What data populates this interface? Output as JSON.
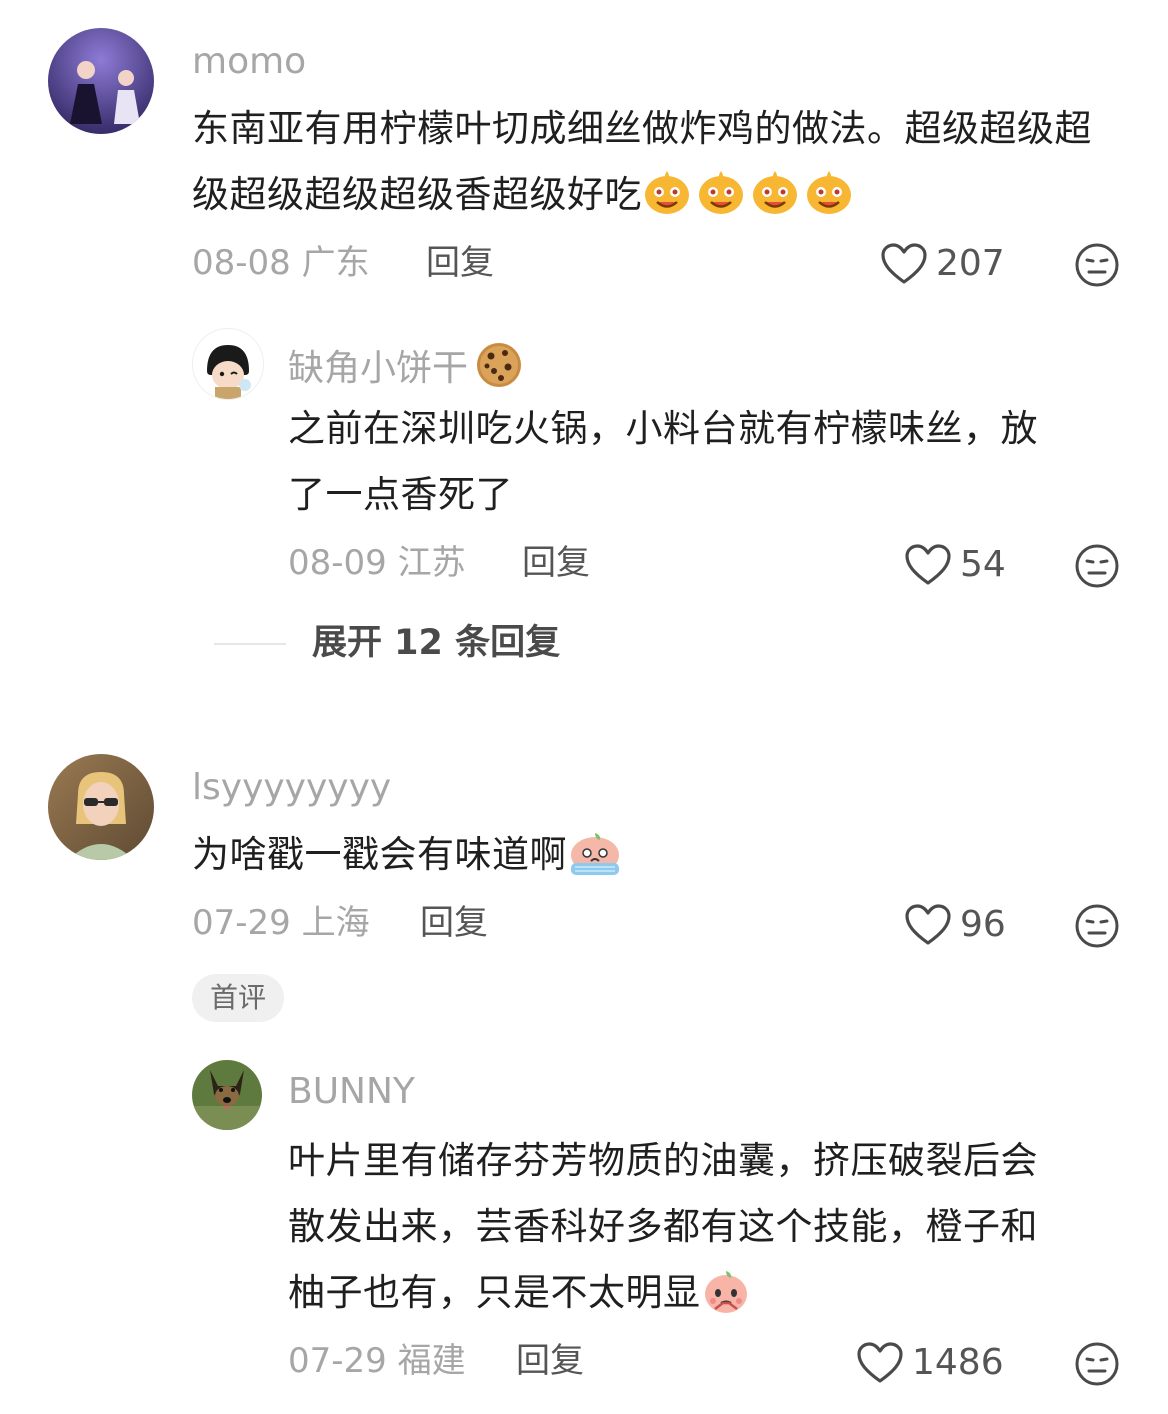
{
  "comments": [
    {
      "username": "momo",
      "text": "东南亚有用柠檬叶切成细丝做炸鸡的做法。超级超级超级超级超级超级香超级好吃",
      "emojis": [
        "drool-face",
        "drool-face",
        "drool-face",
        "drool-face"
      ],
      "date": "08-08",
      "region": "广东",
      "reply_label": "回复",
      "likes": "207",
      "replies": [
        {
          "username": "缺角小饼干",
          "username_emoji": "cookie",
          "text_line1": "之前在深圳吃火锅，小料台就有柠檬味丝，放",
          "text_line2": "了一点香死了",
          "date": "08-09",
          "region": "江苏",
          "reply_label": "回复",
          "likes": "54"
        }
      ],
      "expand_label": "展开 12 条回复"
    },
    {
      "username": "lsyyyyyyyy",
      "text": "为啥戳一戳会有味道啊",
      "emoji": "crying-peach",
      "date": "07-29",
      "region": "上海",
      "reply_label": "回复",
      "likes": "96",
      "badge": "首评",
      "replies": [
        {
          "username": "BUNNY",
          "text_line1": "叶片里有储存芬芳物质的油囊，挤压破裂后会",
          "text_line2": "散发出来，芸香科好多都有这个技能，橙子和",
          "text_line3": "柚子也有，只是不太明显",
          "emoji": "pleading-peach",
          "date": "07-29",
          "region": "福建",
          "reply_label": "回复",
          "likes": "1486"
        }
      ]
    }
  ],
  "colors": {
    "muted": "#a6a6a6",
    "text": "#1f1f1f",
    "icon": "#4a4a4a"
  }
}
